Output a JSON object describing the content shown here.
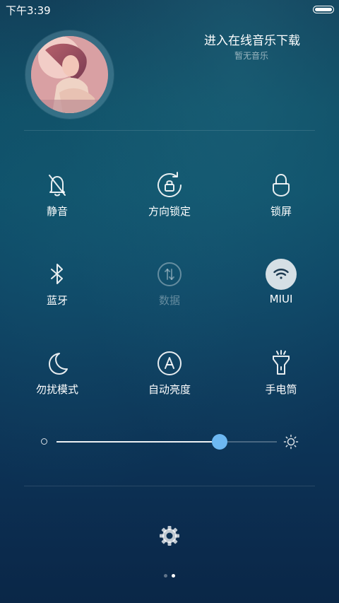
{
  "status_bar": {
    "time": "下午3:39"
  },
  "music": {
    "title": "进入在线音乐下载",
    "subtitle": "暂无音乐"
  },
  "toggles": [
    {
      "label": "静音",
      "icon": "mute-bell-icon",
      "state": "off"
    },
    {
      "label": "方向锁定",
      "icon": "rotation-lock-icon",
      "state": "off"
    },
    {
      "label": "锁屏",
      "icon": "lock-icon",
      "state": "off"
    },
    {
      "label": "蓝牙",
      "icon": "bluetooth-icon",
      "state": "off"
    },
    {
      "label": "数据",
      "icon": "mobile-data-icon",
      "state": "disabled"
    },
    {
      "label": "MIUI",
      "icon": "wifi-icon",
      "state": "on"
    },
    {
      "label": "勿扰模式",
      "icon": "moon-icon",
      "state": "off"
    },
    {
      "label": "自动亮度",
      "icon": "auto-brightness-icon",
      "state": "off"
    },
    {
      "label": "手电筒",
      "icon": "flashlight-icon",
      "state": "off"
    }
  ],
  "brightness": {
    "value_fraction": 0.74
  },
  "pager": {
    "page_count": 2,
    "current_page": 2
  },
  "colors": {
    "slider_thumb": "#6db8f2",
    "wifi_active_bg": "#e6ebf0"
  }
}
